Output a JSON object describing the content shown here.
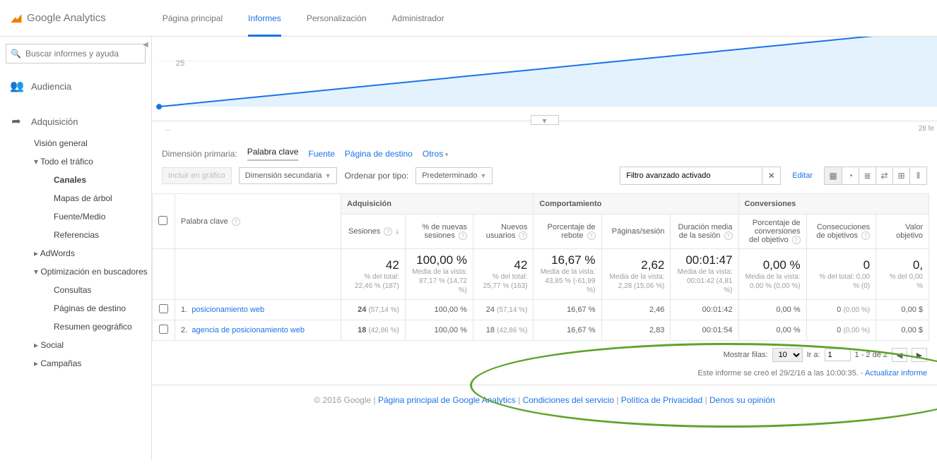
{
  "brand": "Google Analytics",
  "topnav": {
    "home": "Página principal",
    "reports": "Informes",
    "custom": "Personalización",
    "admin": "Administrador"
  },
  "search": {
    "placeholder": "Buscar informes y ayuda"
  },
  "sidebar": {
    "audience": "Audiencia",
    "acquisition": "Adquisición",
    "overview": "Visión general",
    "all_traffic": "Todo el tráfico",
    "channels": "Canales",
    "treemaps": "Mapas de árbol",
    "source_medium": "Fuente/Medio",
    "referrals": "Referencias",
    "adwords": "AdWords",
    "seo": "Optimización en buscadores",
    "queries": "Consultas",
    "landing_pages": "Páginas de destino",
    "geo_summary": "Resumen geográfico",
    "social": "Social",
    "campaigns": "Campañas"
  },
  "chart_data": {
    "type": "area",
    "y_tick": "25",
    "x_start": "...",
    "x_end": "28 fe",
    "points": [
      {
        "x": 0,
        "y": 0
      },
      {
        "x": 1,
        "y": 50
      }
    ],
    "ylim": [
      0,
      50
    ]
  },
  "dim_row": {
    "label": "Dimensión primaria:",
    "active": "Palabra clave",
    "fuente": "Fuente",
    "landing": "Página de destino",
    "others": "Otros"
  },
  "filters": {
    "include_chart": "Incluir en gráfico",
    "secondary_dim": "Dimensión secundaria",
    "sort_label": "Ordenar por tipo:",
    "sort_value": "Predeterminado",
    "advanced": "Filtro avanzado activado",
    "edit": "Editar"
  },
  "table": {
    "col_keyword": "Palabra clave",
    "group_acq": "Adquisición",
    "group_beh": "Comportamiento",
    "group_conv": "Conversiones",
    "col_sessions": "Sesiones",
    "col_newsess": "% de nuevas sesiones",
    "col_newusers": "Nuevos usuarios",
    "col_bounce": "Porcentaje de rebote",
    "col_pages": "Páginas/sesión",
    "col_duration": "Duración media de la sesión",
    "col_convrate": "Porcentaje de conversiones del objetivo",
    "col_goals": "Consecuciones de objetivos",
    "col_value": "Valor objetivo",
    "totals": {
      "sessions_big": "42",
      "sessions_sub": "% del total: 22,46 % (187)",
      "newsess_big": "100,00 %",
      "newsess_sub": "Media de la vista: 87,17 % (14,72 %)",
      "newusers_big": "42",
      "newusers_sub": "% del total: 25,77 % (163)",
      "bounce_big": "16,67 %",
      "bounce_sub": "Media de la vista: 43,85 % (-61,99 %)",
      "pages_big": "2,62",
      "pages_sub": "Media de la vista: 2,28 (15,06 %)",
      "duration_big": "00:01:47",
      "duration_sub": "Media de la vista: 00:01:42 (4,81 %)",
      "convrate_big": "0,00 %",
      "convrate_sub": "Media de la vista: 0,00 % (0,00 %)",
      "goals_big": "0",
      "goals_sub": "% del total: 0,00 % (0)",
      "value_big": "0,",
      "value_sub": "% del 0,00 %"
    },
    "rows": [
      {
        "idx": "1.",
        "keyword": "posicionamiento web",
        "sessions": "24",
        "sessions_pct": "(57,14 %)",
        "newsess": "100,00 %",
        "newusers": "24",
        "newusers_pct": "(57,14 %)",
        "bounce": "16,67 %",
        "pages": "2,46",
        "duration": "00:01:42",
        "convrate": "0,00 %",
        "goals": "0",
        "goals_pct": "(0,00 %)",
        "value": "0,00 $"
      },
      {
        "idx": "2.",
        "keyword": "agencia de posicionamiento web",
        "sessions": "18",
        "sessions_pct": "(42,86 %)",
        "newsess": "100,00 %",
        "newusers": "18",
        "newusers_pct": "(42,86 %)",
        "bounce": "16,67 %",
        "pages": "2,83",
        "duration": "00:01:54",
        "convrate": "0,00 %",
        "goals": "0",
        "goals_pct": "(0,00 %)",
        "value": "0,00 $"
      }
    ]
  },
  "pager": {
    "rows_label": "Mostrar filas:",
    "rows_value": "10",
    "goto_label": "Ir a:",
    "goto_value": "1",
    "range": "1 - 2 de 2"
  },
  "timestamp": {
    "text": "Este informe se creó el 29/2/16 a las 10:00:35. - ",
    "refresh": "Actualizar informe"
  },
  "footer": {
    "copyright": "© 2016 Google",
    "home": "Página principal de Google Analytics",
    "terms": "Condiciones del servicio",
    "privacy": "Política de Privacidad",
    "feedback": "Denos su opinión"
  }
}
